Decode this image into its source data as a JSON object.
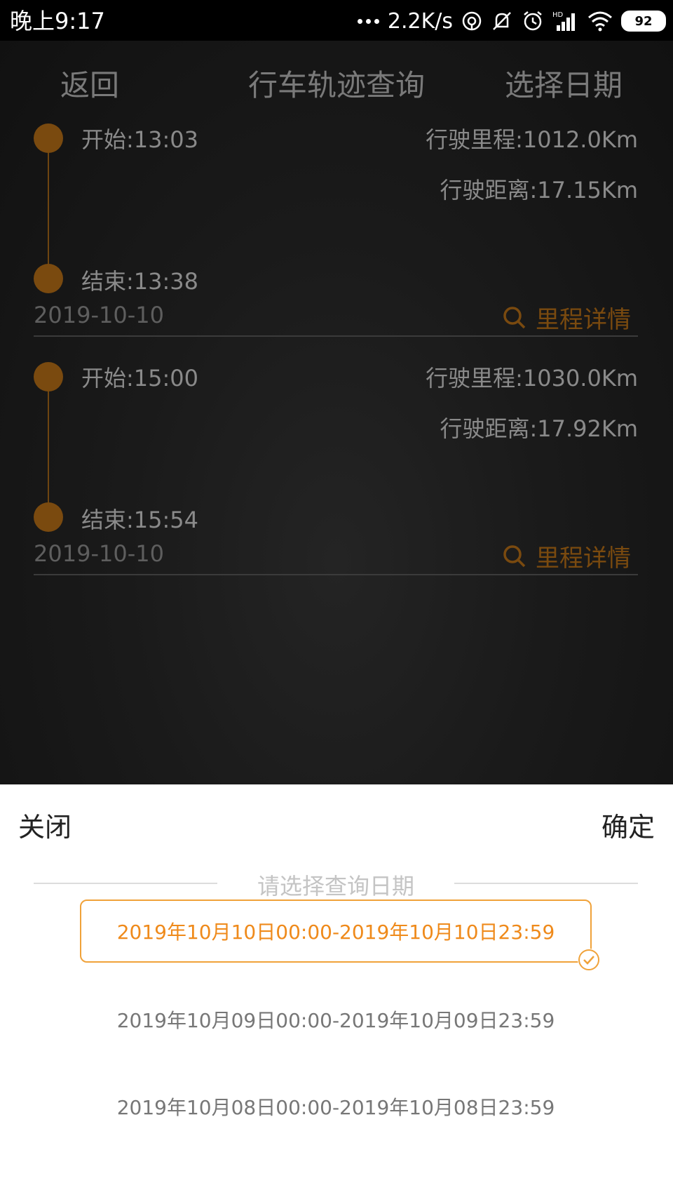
{
  "status_bar": {
    "time": "晚上9:17",
    "speed": "2.2K/s",
    "battery": "92",
    "icons": [
      "dots-icon",
      "hotspot-icon",
      "mute-icon",
      "alarm-icon",
      "hd-signal-icon",
      "wifi-icon",
      "battery-icon"
    ]
  },
  "header": {
    "back_label": "返回",
    "title": "行车轨迹查询",
    "pick_date_label": "选择日期"
  },
  "trips": [
    {
      "start": "开始:13:03",
      "end": "结束:13:38",
      "mileage": "行驶里程:1012.0Km",
      "distance": "行驶距离:17.15Km",
      "date": "2019-10-10",
      "detail_label": "里程详情"
    },
    {
      "start": "开始:15:00",
      "end": "结束:15:54",
      "mileage": "行驶里程:1030.0Km",
      "distance": "行驶距离:17.92Km",
      "date": "2019-10-10",
      "detail_label": "里程详情"
    }
  ],
  "sheet": {
    "close_label": "关闭",
    "confirm_label": "确定",
    "title": "请选择查询日期",
    "options": [
      {
        "label": "2019年10月10日00:00-2019年10月10日23:59",
        "selected": true
      },
      {
        "label": "2019年10月09日00:00-2019年10月09日23:59",
        "selected": false
      },
      {
        "label": "2019年10月08日00:00-2019年10月08日23:59",
        "selected": false
      }
    ]
  },
  "colors": {
    "accent": "#ef8a1b",
    "timeline_brown": "#7a4a0f",
    "dim_text": "#8a8a8a"
  }
}
